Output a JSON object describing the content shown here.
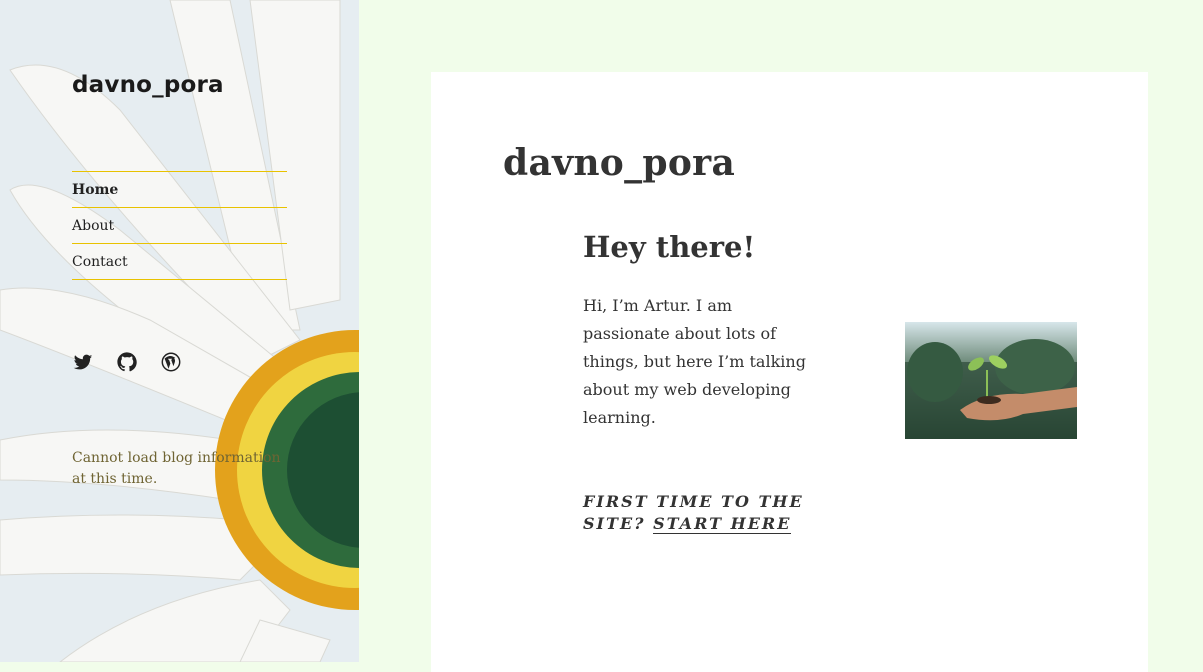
{
  "site": {
    "title": "davno_pora"
  },
  "nav": {
    "items": [
      {
        "label": "Home",
        "active": true
      },
      {
        "label": "About",
        "active": false
      },
      {
        "label": "Contact",
        "active": false
      }
    ]
  },
  "social": [
    {
      "icon": "twitter-icon"
    },
    {
      "icon": "github-icon"
    },
    {
      "icon": "wordpress-icon"
    }
  ],
  "sidebar": {
    "blog_error": "Cannot load blog information at this time."
  },
  "main": {
    "title": "davno_pora",
    "heading": "Hey there!",
    "intro": "Hi, I’m Artur. I am passionate about lots of things, but here I’m talking about my web developing learning.",
    "cta_prefix": "First time to the site? ",
    "cta_link": "Start here"
  },
  "colors": {
    "page_bg": "#f1fdea",
    "nav_border": "#e8c200",
    "error_text": "#6f6433"
  }
}
